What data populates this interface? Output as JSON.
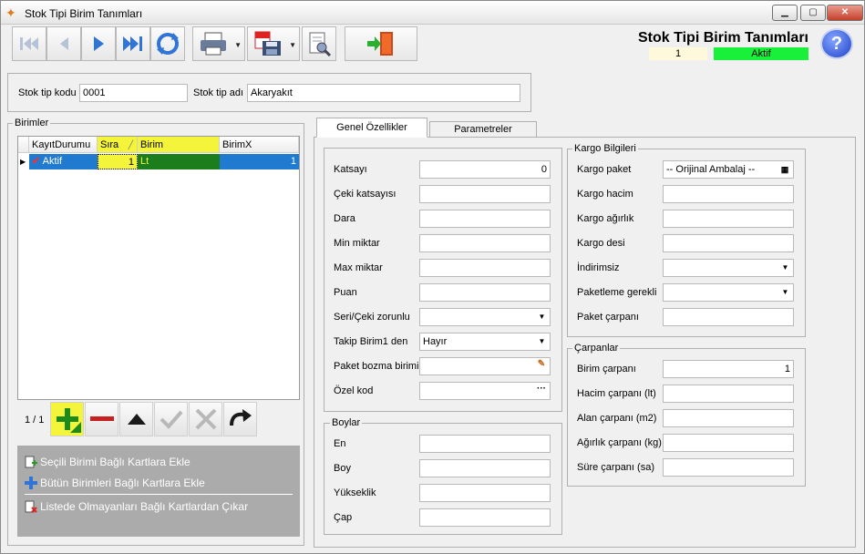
{
  "window": {
    "title": "Stok Tipi Birim Tanımları",
    "minimize": "▁",
    "maximize": "▢",
    "close": "✕"
  },
  "header": {
    "title": "Stok Tipi Birim Tanımları",
    "record_no": "1",
    "status": "Aktif",
    "help": "?"
  },
  "stock": {
    "kod_label": "Stok tip kodu",
    "kod_value": "0001",
    "adi_label": "Stok tip adı",
    "adi_value": "Akaryakıt"
  },
  "birimler": {
    "title": "Birimler",
    "columns": [
      "KayıtDurumu",
      "Sıra",
      "Birim",
      "BirimX"
    ],
    "rows": [
      {
        "durum": "Aktif",
        "sira": "1",
        "birim": "Lt",
        "birimx": "1"
      }
    ],
    "pager": "1 / 1"
  },
  "actions": [
    "Seçili Birimi Bağlı Kartlara Ekle",
    "Bütün Birimleri Bağlı Kartlara Ekle",
    "Listede Olmayanları Bağlı Kartlardan Çıkar"
  ],
  "tabs": [
    "Genel Özellikler",
    "Parametreler"
  ],
  "genel": {
    "katsayi": {
      "label": "Katsayı",
      "value": "0"
    },
    "ceki_katsayisi": {
      "label": "Çeki katsayısı",
      "value": ""
    },
    "dara": {
      "label": "Dara",
      "value": ""
    },
    "min_miktar": {
      "label": "Min miktar",
      "value": ""
    },
    "max_miktar": {
      "label": "Max miktar",
      "value": ""
    },
    "puan": {
      "label": "Puan",
      "value": ""
    },
    "seri_ceki": {
      "label": "Seri/Çeki zorunlu",
      "value": ""
    },
    "takip_birim": {
      "label": "Takip Birim1 den",
      "value": "Hayır"
    },
    "paket_bozma": {
      "label": "Paket bozma birimi",
      "value": ""
    },
    "ozel_kod": {
      "label": "Özel kod",
      "value": ""
    }
  },
  "boylar": {
    "title": "Boylar",
    "en": "En",
    "boy": "Boy",
    "yukseklik": "Yükseklik",
    "cap": "Çap"
  },
  "kargo": {
    "title": "Kargo Bilgileri",
    "paket": {
      "label": "Kargo paket",
      "value": "-- Orijinal Ambalaj --"
    },
    "hacim": "Kargo hacim",
    "agirlik": "Kargo ağırlık",
    "desi": "Kargo desi",
    "indirimsiz": "İndirimsiz",
    "paketleme": "Paketleme gerekli",
    "paket_carpani": "Paket çarpanı"
  },
  "carpanlar": {
    "title": "Çarpanlar",
    "birim": {
      "label": "Birim çarpanı",
      "value": "1"
    },
    "hacim": "Hacim çarpanı (lt)",
    "alan": "Alan çarpanı (m2)",
    "agirlik": "Ağırlık çarpanı (kg)",
    "sure": "Süre çarpanı (sa)"
  },
  "colors": {
    "status_green": "#19f03a",
    "highlight_yellow": "#f4f43a",
    "selected_row": "#1f7ad0",
    "birim_cell": "#1b7d1b"
  }
}
